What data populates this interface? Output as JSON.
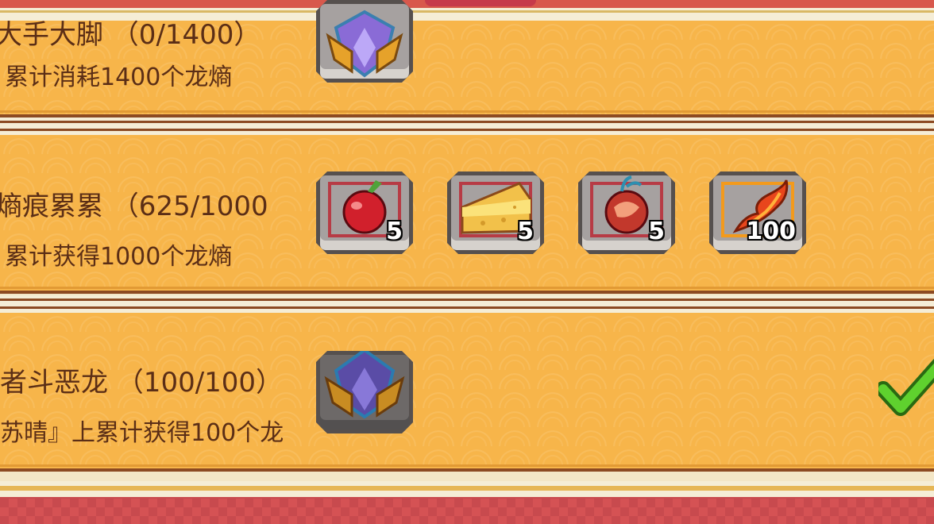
{
  "achievements": [
    {
      "title": "大手大脚 （0/1400）",
      "desc": "累计消耗1400个龙熵",
      "completed": false,
      "rewards": [
        {
          "icon": "dragon-badge-icon",
          "count": ""
        }
      ]
    },
    {
      "title": "熵痕累累 （625/1000",
      "desc": "累计获得1000个龙熵",
      "completed": false,
      "rewards": [
        {
          "icon": "apple-icon",
          "count": "5"
        },
        {
          "icon": "cheese-icon",
          "count": "5"
        },
        {
          "icon": "meat-apple-icon",
          "count": "5"
        },
        {
          "icon": "dragon-entropy-flame-icon",
          "count": "100"
        }
      ]
    },
    {
      "title": "者斗恶龙 （100/100）",
      "desc": "苏晴』上累计获得100个龙",
      "completed": true,
      "rewards": [
        {
          "icon": "dragon-badge-icon",
          "count": ""
        }
      ]
    }
  ],
  "colors": {
    "card": "#f7b54a",
    "text": "#5b2e16",
    "frame_red": "#b73b45",
    "frame_orange": "#f39a1c",
    "check": "#5fd12e"
  }
}
